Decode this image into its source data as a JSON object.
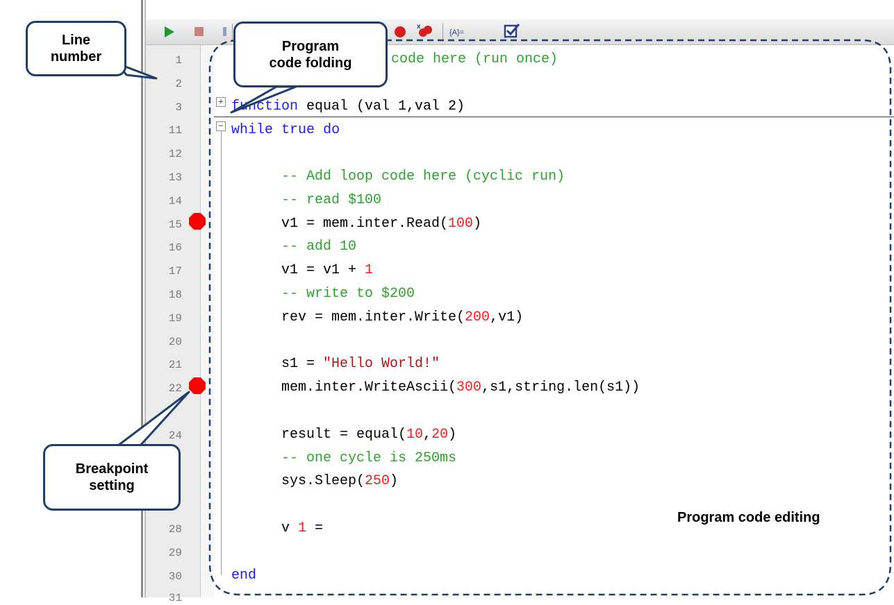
{
  "annotations": {
    "line_number": "Line\nnumber",
    "code_folding": "Program\ncode folding",
    "breakpoint": "Breakpoint\nsetting",
    "editing": "Program code editing"
  },
  "toolbar": {
    "run_icon": "play-icon",
    "stop_icon": "stop-icon",
    "breakpoint_icon": "breakpoint-icon",
    "clear_breakpoints_icon": "clear-breakpoints-icon",
    "variables_icon": "variables-icon",
    "check_icon": "check-icon"
  },
  "lines": [
    {
      "num": "1",
      "breakpoint": false
    },
    {
      "num": "2",
      "breakpoint": false
    },
    {
      "num": "3",
      "breakpoint": false
    },
    {
      "num": "11",
      "breakpoint": false
    },
    {
      "num": "12",
      "breakpoint": false
    },
    {
      "num": "13",
      "breakpoint": false
    },
    {
      "num": "14",
      "breakpoint": false
    },
    {
      "num": "15",
      "breakpoint": true
    },
    {
      "num": "16",
      "breakpoint": false
    },
    {
      "num": "17",
      "breakpoint": false
    },
    {
      "num": "18",
      "breakpoint": false
    },
    {
      "num": "19",
      "breakpoint": false
    },
    {
      "num": "20",
      "breakpoint": false
    },
    {
      "num": "21",
      "breakpoint": false
    },
    {
      "num": "22",
      "breakpoint": true
    },
    {
      "num": "24",
      "breakpoint": false
    },
    {
      "num": "28",
      "breakpoint": false
    },
    {
      "num": "29",
      "breakpoint": false
    },
    {
      "num": "30",
      "breakpoint": false
    },
    {
      "num": "31",
      "breakpoint": false
    }
  ],
  "code": {
    "l1_partial": "l code here (run once)",
    "l3_kw": "function",
    "l3_rest": " equal (val 1,val 2)",
    "l11_kw1": "while",
    "l11_kw2": "true",
    "l11_kw3": "do",
    "l13": "-- Add loop code here (cyclic run)",
    "l14": "-- read $100",
    "l15_a": "v1 = mem.inter.Read(",
    "l15_n": "100",
    "l15_b": ")",
    "l16": "-- add 10",
    "l17_a": "v1 = v1 + ",
    "l17_n": "1",
    "l18": "-- write to $200",
    "l19_a": "rev = mem.inter.Write(",
    "l19_n": "200",
    "l19_b": ",v1)",
    "l21_a": "s1 = ",
    "l21_s": "\"Hello World!\"",
    "l22_a": "mem.inter.WriteAscii(",
    "l22_n": "300",
    "l22_b": ",s1,string.len(s1))",
    "l24_a": "result = equal(",
    "l24_n1": "10",
    "l24_c": ",",
    "l24_n2": "20",
    "l24_b": ")",
    "l25": "-- one cycle is 250ms",
    "l26_a": "sys.Sleep(",
    "l26_n": "250",
    "l26_b": ")",
    "l28_a": "v ",
    "l28_n": "1",
    "l28_b": " =",
    "l30": "end"
  }
}
